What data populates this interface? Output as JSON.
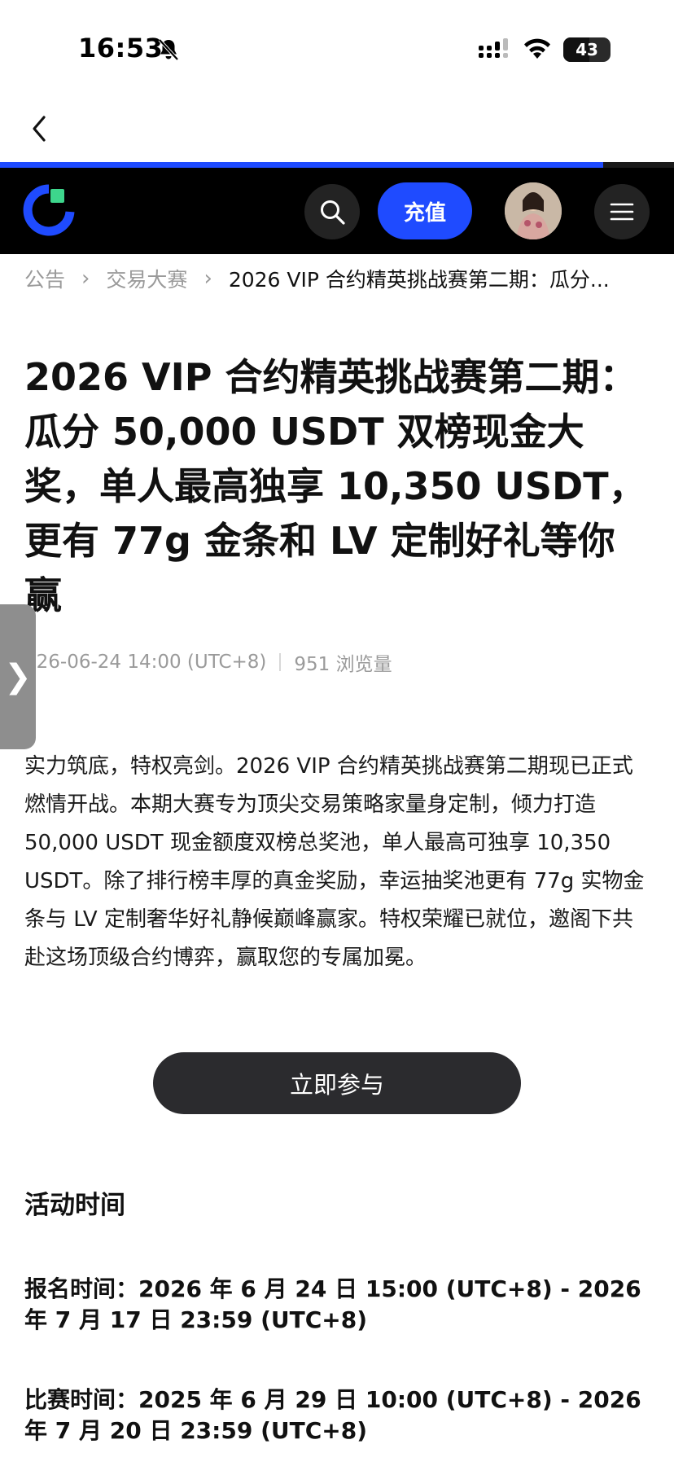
{
  "status_bar": {
    "time": "16:53",
    "battery": "43"
  },
  "browser": {
    "progress_percent": 89.5
  },
  "header": {
    "deposit_label": "充值"
  },
  "breadcrumb": {
    "items": [
      "公告",
      "交易大赛"
    ],
    "current": "2026 VIP 合约精英挑战赛第二期：瓜分..."
  },
  "article": {
    "title": "2026 VIP 合约精英挑战赛第二期：瓜分 50,000 USDT 双榜现金大奖，单人最高独享 10,350 USDT，更有 77g 金条和 LV 定制好礼等你赢",
    "date": "026-06-24 14:00 (UTC+8)",
    "views": "951 浏览量",
    "body": "实力筑底，特权亮剑。2026 VIP 合约精英挑战赛第二期现已正式燃情开战。本期大赛专为顶尖交易策略家量身定制，倾力打造 50,000 USDT 现金额度双榜总奖池，单人最高可独享 10,350 USDT。除了排行榜丰厚的真金奖励，幸运抽奖池更有 77g 实物金条与 LV 定制奢华好礼静候巅峰赢家。特权荣耀已就位，邀阁下共赴这场顶级合约博弈，赢取您的专属加冕。",
    "cta_label": "立即参与"
  },
  "schedule": {
    "heading": "活动时间",
    "registration": "报名时间：2026 年 6 月 24 日 15:00 (UTC+8) - 2026 年 7 月 17 日 23:59 (UTC+8)",
    "competition": "比赛时间：2025 年 6 月 29 日 10:00 (UTC+8) - 2026 年 7 月 20 日 23:59 (UTC+8)"
  },
  "icons": {
    "back": "chevron-left-icon",
    "search": "search-icon",
    "menu": "hamburger-menu-icon",
    "side_handle": "chevron-right-icon",
    "bell": "bell-slash-icon"
  },
  "colors": {
    "brand_blue": "#1f4bff",
    "header_bg": "#000000",
    "cta_bg": "#2b2b2e",
    "muted_text": "#9a9a9a"
  }
}
